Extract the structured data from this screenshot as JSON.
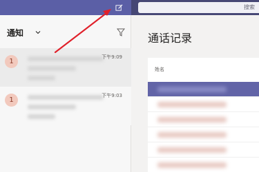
{
  "topbar": {
    "search_placeholder": "搜索"
  },
  "activity": {
    "title": "通知",
    "items": [
      {
        "avatar": "1",
        "time": "下午9:09"
      },
      {
        "avatar": "1",
        "time": "下午9:03"
      }
    ]
  },
  "calls": {
    "title": "通话记录",
    "column_name": "姓名"
  },
  "colors": {
    "accent": "#6264a7",
    "topbar": "#464775",
    "annotation": "#e0202a"
  },
  "icons": {
    "compose": "compose-icon",
    "filter": "filter-icon",
    "chevron": "chevron-down-icon"
  }
}
